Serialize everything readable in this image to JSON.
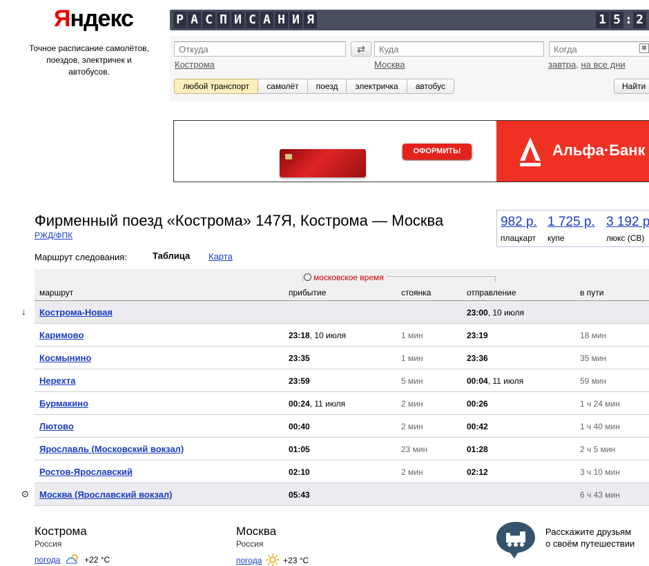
{
  "header": {
    "logo_text": "Яндекс",
    "tagline": "Точное расписание самолётов, поездов, электричек и автобусов.",
    "board_title": "РАСПИСАНИЯ",
    "clock": "15:2"
  },
  "search": {
    "from_placeholder": "Откуда",
    "to_placeholder": "Куда",
    "when_placeholder": "Когда",
    "from_suggest": "Кострома",
    "to_suggest": "Москва",
    "when_suggest_1": "завтра",
    "when_suggest_sep": ",",
    "when_suggest_2": "на все дни",
    "transport_tabs": [
      "любой транспорт",
      "самолёт",
      "поезд",
      "электричка",
      "автобус"
    ],
    "find_label": "Найти"
  },
  "banner": {
    "order_label": "ОФОРМИТЬ!",
    "bank_name": "Альфа·Банк",
    "colors": {
      "alfa_red": "#ef3124"
    }
  },
  "train": {
    "title": "Фирменный поезд «Кострома» 147Я, Кострома — Москва",
    "carrier": "РЖД/ФПК",
    "route_label": "Маршрут следования:",
    "view_table": "Таблица",
    "view_map": "Карта"
  },
  "prices": [
    {
      "price": "982 р.",
      "class": "плацкарт"
    },
    {
      "price": "1 725 р.",
      "class": "купе"
    },
    {
      "price": "3 192 р.",
      "class": "люкс (СВ)"
    }
  ],
  "table": {
    "moscow_time": "московское время",
    "headers": {
      "route": "маршрут",
      "arrival": "прибытие",
      "stop": "стоянка",
      "departure": "отправление",
      "travel": "в пути"
    },
    "rows": [
      {
        "station": "Кострома-Новая",
        "arr_time": "",
        "arr_date": "",
        "stop": "",
        "dep_time": "23:00",
        "dep_date": ", 10 июля",
        "travel": ""
      },
      {
        "station": "Каримово",
        "arr_time": "23:18",
        "arr_date": ", 10 июля",
        "stop": "1 мин",
        "dep_time": "23:19",
        "dep_date": "",
        "travel": "18 мин"
      },
      {
        "station": "Космынино",
        "arr_time": "23:35",
        "arr_date": "",
        "stop": "1 мин",
        "dep_time": "23:36",
        "dep_date": "",
        "travel": "35 мин"
      },
      {
        "station": "Нерехта",
        "arr_time": "23:59",
        "arr_date": "",
        "stop": "5 мин",
        "dep_time": "00:04",
        "dep_date": ", 11 июля",
        "travel": "59 мин"
      },
      {
        "station": "Бурмакино",
        "arr_time": "00:24",
        "arr_date": ", 11 июля",
        "stop": "2 мин",
        "dep_time": "00:26",
        "dep_date": "",
        "travel": "1 ч 24 мин"
      },
      {
        "station": "Лютово",
        "arr_time": "00:40",
        "arr_date": "",
        "stop": "2 мин",
        "dep_time": "00:42",
        "dep_date": "",
        "travel": "1 ч 40 мин"
      },
      {
        "station": "Ярославль (Московский вокзал)",
        "arr_time": "01:05",
        "arr_date": "",
        "stop": "23 мин",
        "dep_time": "01:28",
        "dep_date": "",
        "travel": "2 ч 5 мин"
      },
      {
        "station": "Ростов-Ярославский",
        "arr_time": "02:10",
        "arr_date": "",
        "stop": "2 мин",
        "dep_time": "02:12",
        "dep_date": "",
        "travel": "3 ч 10 мин"
      },
      {
        "station": "Москва (Ярославский вокзал)",
        "arr_time": "05:43",
        "arr_date": "",
        "stop": "",
        "dep_time": "",
        "dep_date": "",
        "travel": "6 ч 43 мин"
      }
    ],
    "start_marker": "↓",
    "end_marker": "⊙"
  },
  "footer": {
    "from_city": {
      "name": "Кострома",
      "country": "Россия",
      "weather_link": "погода",
      "temp": "+22 °C",
      "icon": "cloudy-sun-icon"
    },
    "to_city": {
      "name": "Москва",
      "country": "Россия",
      "weather_link": "погода",
      "temp": "+23 °C",
      "icon": "sun-icon"
    },
    "share_text_1": "Расскажите друзьям",
    "share_text_2": "о своём путешествии"
  }
}
